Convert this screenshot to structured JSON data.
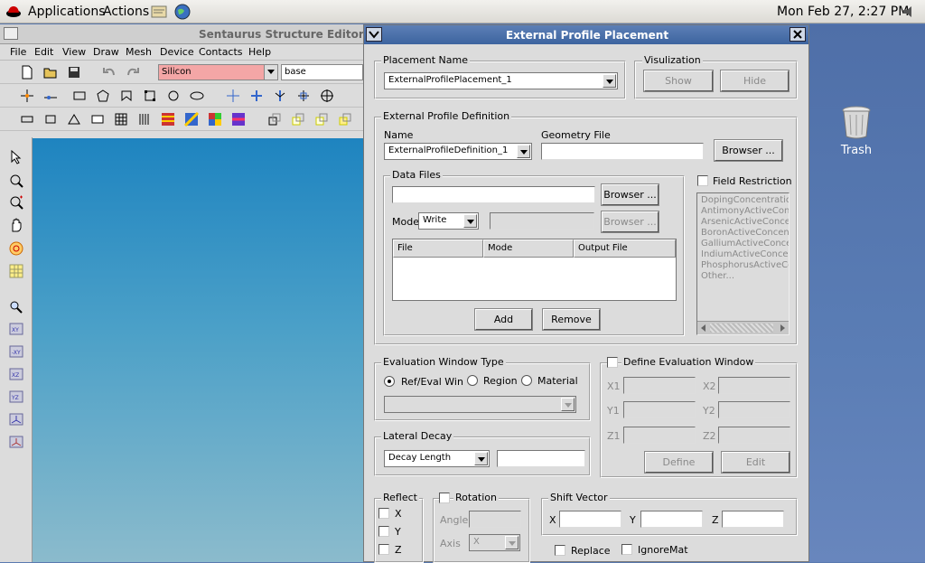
{
  "topbar": {
    "applications": "Applications",
    "actions": "Actions",
    "clock": "Mon Feb 27,  2:27 PM"
  },
  "desktop": {
    "trash_label": "Trash"
  },
  "editor": {
    "title": "Sentaurus Structure Editor@",
    "menus": [
      "File",
      "Edit",
      "View",
      "Draw",
      "Mesh",
      "Device",
      "Contacts",
      "Help"
    ],
    "material_value": "Silicon",
    "region_value": "base"
  },
  "dialog": {
    "title": "External Profile Placement",
    "placement": {
      "group_label": "Placement Name",
      "value": "ExternalProfilePlacement_1"
    },
    "visualization": {
      "group_label": "Visulization",
      "show": "Show",
      "hide": "Hide"
    },
    "epd": {
      "group_label": "External Profile Definition",
      "name_label": "Name",
      "name_value": "ExternalProfileDefinition_1",
      "geometry_label": "Geometry File",
      "geometry_value": "",
      "browse": "Browser ...",
      "data_files_label": "Data Files",
      "data_file_value": "",
      "browse2": "Browser ...",
      "mode_label": "Mode",
      "mode_value": "Write",
      "browse3": "Browser ...",
      "columns": [
        "File",
        "Mode",
        "Output File"
      ],
      "add": "Add",
      "remove": "Remove",
      "field_restriction": "Field Restriction",
      "fields": [
        "DopingConcentration",
        "AntimonyActiveConc",
        "ArsenicActiveConcen",
        "BoronActiveConcent",
        "GalliumActiveConcen",
        "IndiumActiveConcent",
        "PhosphorusActiveCo",
        "Other..."
      ]
    },
    "eval_type": {
      "group_label": "Evaluation Window Type",
      "options": [
        "Ref/Eval Win",
        "Region",
        "Material"
      ],
      "selected": 0
    },
    "eval_window": {
      "label": "Define Evaluation Window",
      "x1": "X1",
      "x2": "X2",
      "y1": "Y1",
      "y2": "Y2",
      "z1": "Z1",
      "z2": "Z2",
      "define": "Define",
      "edit": "Edit"
    },
    "lateral": {
      "group_label": "Lateral Decay",
      "mode_value": "Decay Length",
      "value": ""
    },
    "reflect": {
      "group_label": "Reflect",
      "x": "X",
      "y": "Y",
      "z": "Z"
    },
    "rotation": {
      "label": "Rotation",
      "angle": "Angle",
      "axis": "Axis",
      "axis_value": "X"
    },
    "shift": {
      "group_label": "Shift Vector",
      "x": "X",
      "y": "Y",
      "z": "Z"
    },
    "replace": "Replace",
    "ignoremat": "IgnoreMat"
  }
}
